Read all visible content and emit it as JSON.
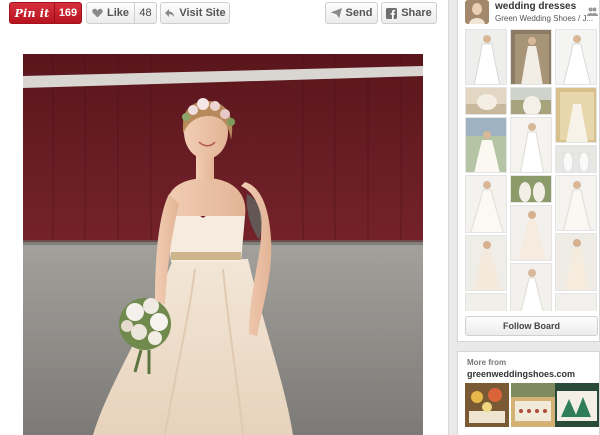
{
  "toolbar": {
    "pin_it_label": "Pin it",
    "pin_count": "169",
    "like_label": "Like",
    "like_count": "48",
    "visit_site_label": "Visit Site",
    "send_label": "Send",
    "share_label": "Share"
  },
  "board": {
    "title": "wedding dresses",
    "source": "Green Wedding Shoes / J...",
    "follow_label": "Follow Board"
  },
  "more_from": {
    "label": "More from",
    "source": "greenweddingshoes.com"
  },
  "colors": {
    "pin_red": "#c8232c",
    "barn_red": "#6b1e24"
  }
}
